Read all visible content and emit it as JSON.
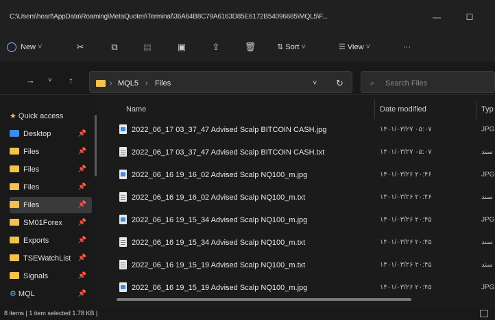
{
  "window": {
    "title": "C:\\Users\\heart\\AppData\\Roaming\\MetaQuotes\\Terminal\\36A64B8C79A6163D85E6172B54096685\\MQL5\\F..."
  },
  "command_bar": {
    "new_label": "New",
    "sort_label": "Sort",
    "view_label": "View",
    "more_label": "···"
  },
  "address_bar": {
    "crumbs": [
      "MQL5",
      "Files"
    ],
    "search_placeholder": "Search Files"
  },
  "sidebar": {
    "items": [
      {
        "label": "Quick access",
        "icon": "star-icon"
      },
      {
        "label": "Desktop",
        "icon": "desktop-icon"
      },
      {
        "label": "Files",
        "icon": "folder-icon"
      },
      {
        "label": "Files",
        "icon": "folder-icon"
      },
      {
        "label": "Files",
        "icon": "folder-icon"
      },
      {
        "label": "Files",
        "icon": "folder-icon"
      },
      {
        "label": "SM01Forex",
        "icon": "folder-icon"
      },
      {
        "label": "Exports",
        "icon": "folder-icon"
      },
      {
        "label": "TSEWatchList",
        "icon": "folder-icon"
      },
      {
        "label": "Signals",
        "icon": "folder-icon"
      },
      {
        "label": "MQL",
        "icon": "app-icon"
      }
    ]
  },
  "columns": {
    "name": "Name",
    "date_modified": "Date modified",
    "type": "Typ"
  },
  "files": [
    {
      "name": "2022_06_17 03_37_47 Advised Scalp BITCOIN CASH.jpg",
      "date": "۱۴۰۱/۰۳/۲۷ ۰۵:۰۷",
      "type": "JPG",
      "kind": "img"
    },
    {
      "name": "2022_06_17 03_37_47 Advised Scalp BITCOIN CASH.txt",
      "date": "۱۴۰۱/۰۳/۲۷ ۰۵:۰۷",
      "type": "ﺳﻨﺪ",
      "kind": "txt"
    },
    {
      "name": "2022_06_16 19_16_02 Advised Scalp NQ100_m.jpg",
      "date": "۱۴۰۱/۰۳/۲۶ ۲۰:۴۶",
      "type": "JPG",
      "kind": "img"
    },
    {
      "name": "2022_06_16 19_16_02 Advised Scalp NQ100_m.txt",
      "date": "۱۴۰۱/۰۳/۲۶ ۲۰:۴۶",
      "type": "ﺳﻨﺪ",
      "kind": "txt"
    },
    {
      "name": "2022_06_16 19_15_34 Advised Scalp NQ100_m.jpg",
      "date": "۱۴۰۱/۰۳/۲۶ ۲۰:۴۵",
      "type": "JPG",
      "kind": "img"
    },
    {
      "name": "2022_06_16 19_15_34 Advised Scalp NQ100_m.txt",
      "date": "۱۴۰۱/۰۳/۲۶ ۲۰:۴۵",
      "type": "ﺳﻨﺪ",
      "kind": "txt"
    },
    {
      "name": "2022_06_16 19_15_19 Advised Scalp NQ100_m.txt",
      "date": "۱۴۰۱/۰۳/۲۶ ۲۰:۴۵",
      "type": "ﺳﻨﺪ",
      "kind": "txt"
    },
    {
      "name": "2022_06_16 19_15_19 Advised Scalp NQ100_m.jpg",
      "date": "۱۴۰۱/۰۳/۲۶ ۲۰:۴۵",
      "type": "JPG",
      "kind": "img"
    }
  ],
  "status": {
    "text": "8 items  |  1 item selected  1.78 KB  |"
  },
  "colors": {
    "background": "#1b1b1b",
    "folder": "#f2c14e",
    "accent": "#3c8ee8"
  }
}
